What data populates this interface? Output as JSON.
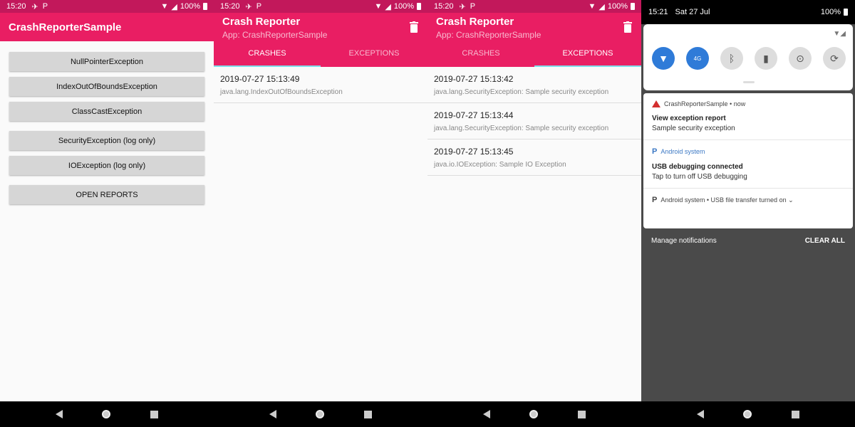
{
  "status": {
    "time": "15:20",
    "battery": "100%"
  },
  "screen1": {
    "app_title": "CrashReporterSample",
    "buttons": [
      "NullPointerException",
      "IndexOutOfBoundsException",
      "ClassCastException",
      "SecurityException (log only)",
      "IOException (log only)",
      "OPEN REPORTS"
    ]
  },
  "reporter": {
    "title": "Crash Reporter",
    "subtitle": "App: CrashReporterSample",
    "tabs": [
      "CRASHES",
      "EXCEPTIONS"
    ]
  },
  "crashes": [
    {
      "date": "2019-07-27 15:13:49",
      "exception": "java.lang.IndexOutOfBoundsException"
    }
  ],
  "exceptions": [
    {
      "date": "2019-07-27 15:13:42",
      "exception": "java.lang.SecurityException: Sample security exception"
    },
    {
      "date": "2019-07-27 15:13:44",
      "exception": "java.lang.SecurityException: Sample security exception"
    },
    {
      "date": "2019-07-27 15:13:45",
      "exception": "java.io.IOException: Sample IO Exception"
    }
  ],
  "shade": {
    "time": "15:21",
    "date": "Sat 27 Jul",
    "battery": "100%",
    "tiles": [
      "wifi-icon",
      "mobile-data-icon",
      "bluetooth-icon",
      "flashlight-icon",
      "location-icon",
      "auto-rotate-icon"
    ],
    "tile_text": {
      "mobile": "4G"
    },
    "notifications": [
      {
        "app": "CrashReporterSample • now",
        "title": "View exception report",
        "text": "Sample security exception"
      },
      {
        "app": "Android system",
        "title": "USB debugging connected",
        "text": "Tap to turn off USB debugging"
      },
      {
        "app": "Android system • USB file transfer turned on ⌄"
      }
    ],
    "manage": "Manage notifications",
    "clear_all": "CLEAR ALL"
  },
  "colors": {
    "primary": "#e91e63",
    "status": "#c2185b",
    "tab_indicator": "#80deea",
    "shade_bg": "#4a4a4a"
  }
}
